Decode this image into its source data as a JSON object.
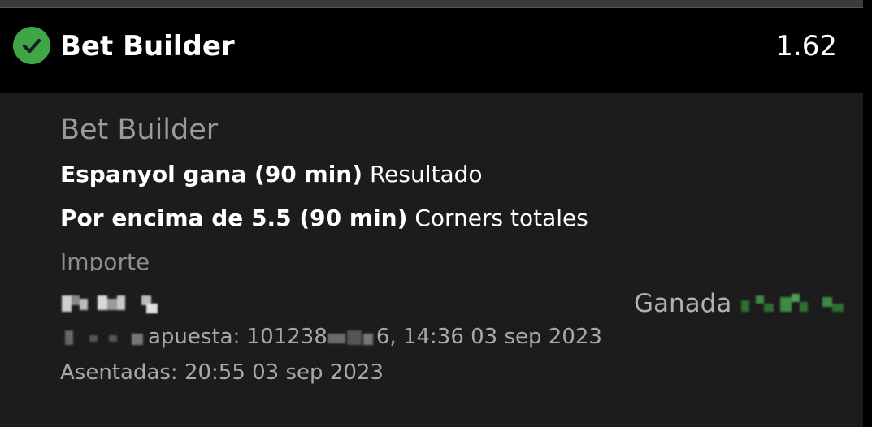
{
  "header": {
    "title": "Bet Builder",
    "odds": "1.62",
    "status_icon": "check-circle-icon",
    "status_color": "#3fa648"
  },
  "card": {
    "subtitle": "Bet Builder",
    "selections": [
      {
        "pick": "Espanyol gana (90 min)",
        "market": "Resultado"
      },
      {
        "pick": "Por encima de 5.5 (90 min)",
        "market": "Corners totales"
      }
    ],
    "stake_label": "Importe",
    "result_label": "Ganada",
    "bet_id_label": "apuesta: 101238",
    "bet_id_suffix": "6, 14:36 03 sep 2023",
    "placed_label": "Asentadas: 20:55 03 sep 2023"
  },
  "colors": {
    "background": "#000000",
    "card": "#1c1c1c",
    "accent_green": "#3fa648",
    "muted_text": "#9a9a9a"
  }
}
